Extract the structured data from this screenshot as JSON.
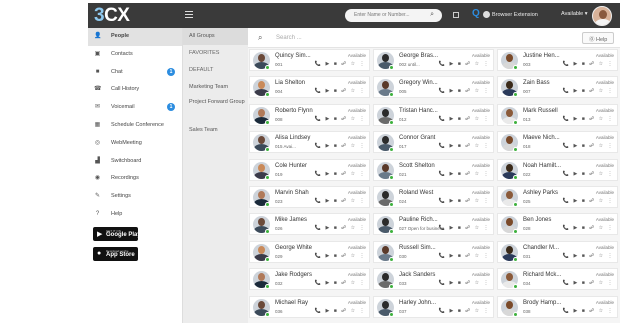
{
  "topbar": {
    "logo_number": "3",
    "logo_text": "CX",
    "search_placeholder": "Enter Name or Number...",
    "q_label": "Q",
    "browser_extension": "Browser Extension",
    "status": "Available",
    "status_caret": "▾"
  },
  "sidebar": {
    "items": [
      {
        "label": "People",
        "icon": "person-icon",
        "glyph": "👤",
        "active": true
      },
      {
        "label": "Contacts",
        "icon": "contacts-icon",
        "glyph": "▣"
      },
      {
        "label": "Chat",
        "icon": "chat-icon",
        "glyph": "■",
        "badge": "1"
      },
      {
        "label": "Call History",
        "icon": "call-history-icon",
        "glyph": "☎"
      },
      {
        "label": "Voicemail",
        "icon": "voicemail-icon",
        "glyph": "✉",
        "badge": "1"
      },
      {
        "label": "Schedule Conference",
        "icon": "calendar-icon",
        "glyph": "▦"
      },
      {
        "label": "WebMeeting",
        "icon": "webmeeting-icon",
        "glyph": "◎"
      },
      {
        "label": "Switchboard",
        "icon": "switchboard-icon",
        "glyph": "▟"
      },
      {
        "label": "Recordings",
        "icon": "recordings-icon",
        "glyph": "◉"
      },
      {
        "label": "Settings",
        "icon": "settings-icon",
        "glyph": "✎"
      },
      {
        "label": "Help",
        "icon": "help-icon",
        "glyph": "?"
      }
    ],
    "google_play_small": "GET IT ON",
    "google_play_large": "Google Play",
    "app_store_small": "Download on the",
    "app_store_large": "App Store"
  },
  "groups": {
    "items": [
      "All Groups",
      "FAVORITES",
      "DEFAULT",
      "Marketing Team",
      "Project Forward Group",
      "Sales Team"
    ]
  },
  "content": {
    "search_placeholder": "Search ...",
    "help_label": "Help",
    "action_icons": "📞 ▶ ■ ☍ ☆ ⋮"
  },
  "colors": {
    "topbar": "#3a3a3a",
    "accent": "#2c8de0",
    "presence_available": "#3db13d"
  },
  "contacts": [
    {
      "name": "Quincy Sim...",
      "ext": "001",
      "status": "Available"
    },
    {
      "name": "George Bras...",
      "ext": "002 until...",
      "status": "Available"
    },
    {
      "name": "Justine Hen...",
      "ext": "003",
      "status": "Available"
    },
    {
      "name": "Lia Shelton",
      "ext": "004",
      "status": "Available"
    },
    {
      "name": "Gregory Win...",
      "ext": "005",
      "status": "Available"
    },
    {
      "name": "Zain Bass",
      "ext": "007",
      "status": "Available"
    },
    {
      "name": "Roberto Flynn",
      "ext": "008",
      "status": "Available"
    },
    {
      "name": "Tristan Hanc...",
      "ext": "012",
      "status": "Available"
    },
    {
      "name": "Mark Russell",
      "ext": "013",
      "status": "Available"
    },
    {
      "name": "Alisa Lindsey",
      "ext": "015 Avai...",
      "status": "Available"
    },
    {
      "name": "Connor Grant",
      "ext": "017",
      "status": "Available"
    },
    {
      "name": "Maeve Nich...",
      "ext": "018",
      "status": "Available"
    },
    {
      "name": "Cole Hunter",
      "ext": "019",
      "status": "Available"
    },
    {
      "name": "Scott Shelton",
      "ext": "021",
      "status": "Available"
    },
    {
      "name": "Noah Hamilt...",
      "ext": "022",
      "status": "Available"
    },
    {
      "name": "Marvin Shah",
      "ext": "023",
      "status": "Available"
    },
    {
      "name": "Roland West",
      "ext": "024",
      "status": "Available"
    },
    {
      "name": "Ashley Parks",
      "ext": "025",
      "status": "Available"
    },
    {
      "name": "Mike James",
      "ext": "026",
      "status": "Available"
    },
    {
      "name": "Pauline Rich...",
      "ext": "027 Open for business",
      "status": "Available"
    },
    {
      "name": "Ben Jones",
      "ext": "028",
      "status": "Available"
    },
    {
      "name": "George White",
      "ext": "029",
      "status": "Available"
    },
    {
      "name": "Russell Sim...",
      "ext": "030",
      "status": "Available"
    },
    {
      "name": "Chandler M...",
      "ext": "031",
      "status": "Available"
    },
    {
      "name": "Jake Rodgers",
      "ext": "032",
      "status": "Available"
    },
    {
      "name": "Jack Sanders",
      "ext": "033",
      "status": "Available"
    },
    {
      "name": "Richard Mck...",
      "ext": "034",
      "status": "Available"
    },
    {
      "name": "Michael Ray",
      "ext": "036",
      "status": "Available"
    },
    {
      "name": "Harley John...",
      "ext": "037",
      "status": "Available"
    },
    {
      "name": "Brody Hamp...",
      "ext": "038",
      "status": "Available"
    }
  ]
}
